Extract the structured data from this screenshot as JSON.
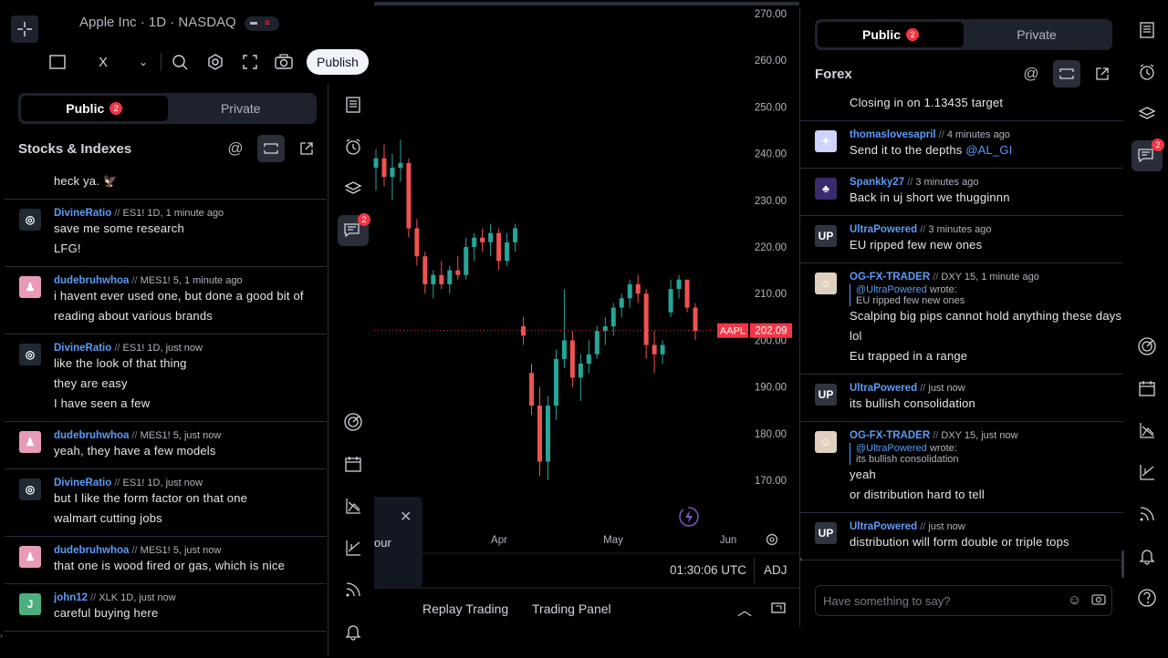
{
  "chart": {
    "symbol_title": "Apple Inc · 1D · NASDAQ",
    "toolbar": {
      "close_label": "X",
      "publish_label": "Publish"
    },
    "price_scale": [
      "270.00",
      "260.00",
      "250.00",
      "240.00",
      "230.00",
      "220.00",
      "210.00",
      "200.00",
      "190.00",
      "180.00",
      "170.00"
    ],
    "time_labels": [
      "Apr",
      "May",
      "Jun"
    ],
    "last_price": {
      "symbol": "AAPL",
      "price": "202.09"
    },
    "clock": "01:30:06 UTC",
    "adj_label": "ADJ",
    "toast_fragment": "our",
    "bottom_tabs": [
      "Replay Trading",
      "Trading Panel"
    ],
    "colors": {
      "up": "#26a69a",
      "down": "#ef5350",
      "accent": "#f23645"
    }
  },
  "chart_data": {
    "type": "candlestick",
    "title": "Apple Inc · 1D · NASDAQ",
    "ylim": [
      165,
      272
    ],
    "series": [
      {
        "name": "AAPL",
        "last": 202.09
      }
    ],
    "x_tick_labels": [
      "Apr",
      "May",
      "Jun"
    ],
    "candles": [
      {
        "o": 237,
        "h": 241,
        "l": 232,
        "c": 239
      },
      {
        "o": 239,
        "h": 242,
        "l": 233,
        "c": 235
      },
      {
        "o": 235,
        "h": 240,
        "l": 230,
        "c": 237
      },
      {
        "o": 237,
        "h": 243,
        "l": 234,
        "c": 238
      },
      {
        "o": 238,
        "h": 239,
        "l": 222,
        "c": 224
      },
      {
        "o": 224,
        "h": 226,
        "l": 216,
        "c": 218
      },
      {
        "o": 218,
        "h": 219,
        "l": 210,
        "c": 212
      },
      {
        "o": 212,
        "h": 215,
        "l": 209,
        "c": 214
      },
      {
        "o": 214,
        "h": 217,
        "l": 211,
        "c": 212
      },
      {
        "o": 212,
        "h": 216,
        "l": 210,
        "c": 215
      },
      {
        "o": 215,
        "h": 218,
        "l": 213,
        "c": 214
      },
      {
        "o": 214,
        "h": 222,
        "l": 213,
        "c": 220
      },
      {
        "o": 220,
        "h": 223,
        "l": 217,
        "c": 222
      },
      {
        "o": 222,
        "h": 224,
        "l": 219,
        "c": 221
      },
      {
        "o": 221,
        "h": 225,
        "l": 218,
        "c": 223
      },
      {
        "o": 223,
        "h": 224,
        "l": 215,
        "c": 217
      },
      {
        "o": 217,
        "h": 223,
        "l": 216,
        "c": 221
      },
      {
        "o": 221,
        "h": 225,
        "l": 219,
        "c": 224
      },
      {
        "o": 203,
        "h": 205,
        "l": 199,
        "c": 201
      },
      {
        "o": 193,
        "h": 195,
        "l": 184,
        "c": 186
      },
      {
        "o": 186,
        "h": 190,
        "l": 171,
        "c": 174
      },
      {
        "o": 174,
        "h": 188,
        "l": 170,
        "c": 186
      },
      {
        "o": 186,
        "h": 198,
        "l": 183,
        "c": 196
      },
      {
        "o": 196,
        "h": 211,
        "l": 194,
        "c": 200
      },
      {
        "o": 200,
        "h": 202,
        "l": 190,
        "c": 192
      },
      {
        "o": 192,
        "h": 197,
        "l": 187,
        "c": 195
      },
      {
        "o": 195,
        "h": 200,
        "l": 193,
        "c": 197
      },
      {
        "o": 197,
        "h": 203,
        "l": 196,
        "c": 202
      },
      {
        "o": 202,
        "h": 205,
        "l": 199,
        "c": 203
      },
      {
        "o": 203,
        "h": 208,
        "l": 201,
        "c": 207
      },
      {
        "o": 207,
        "h": 210,
        "l": 205,
        "c": 209
      },
      {
        "o": 209,
        "h": 213,
        "l": 207,
        "c": 212
      },
      {
        "o": 212,
        "h": 214,
        "l": 208,
        "c": 210
      },
      {
        "o": 210,
        "h": 211,
        "l": 196,
        "c": 199
      },
      {
        "o": 199,
        "h": 202,
        "l": 193,
        "c": 197
      },
      {
        "o": 197,
        "h": 200,
        "l": 195,
        "c": 199
      },
      {
        "o": 206,
        "h": 213,
        "l": 205,
        "c": 211
      },
      {
        "o": 211,
        "h": 214,
        "l": 209,
        "c": 213
      },
      {
        "o": 213,
        "h": 213,
        "l": 206,
        "c": 207
      },
      {
        "o": 207,
        "h": 208,
        "l": 200,
        "c": 202
      }
    ]
  },
  "left_chat": {
    "tabs": {
      "public": "Public",
      "public_badge": "2",
      "private": "Private"
    },
    "room": "Stocks & Indexes",
    "messages": [
      {
        "user": "",
        "meta": "",
        "lines": [
          "heck ya. 🦅"
        ],
        "avatar": "",
        "color": "#000"
      },
      {
        "user": "DivineRatio",
        "meta": "ES1! 1D, 1 minute ago",
        "lines": [
          "save me some research",
          "LFG!"
        ],
        "avatar": "◎",
        "color": "#1f2a33"
      },
      {
        "user": "dudebruhwhoa",
        "meta": "MES1! 5, 1 minute ago",
        "lines": [
          "i havent ever used one, but done a good bit of reading about various brands"
        ],
        "avatar": "♟",
        "color": "#e89bb8"
      },
      {
        "user": "DivineRatio",
        "meta": "ES1! 1D, just now",
        "lines": [
          "like the look of that thing",
          "they are easy",
          "I have seen a few"
        ],
        "avatar": "◎",
        "color": "#1f2a33"
      },
      {
        "user": "dudebruhwhoa",
        "meta": "MES1! 5, just now",
        "lines": [
          "yeah, they have a few models"
        ],
        "avatar": "♟",
        "color": "#e89bb8"
      },
      {
        "user": "DivineRatio",
        "meta": "ES1! 1D, just now",
        "lines": [
          "but I like the form factor on that one",
          "walmart cutting jobs"
        ],
        "avatar": "◎",
        "color": "#1f2a33"
      },
      {
        "user": "dudebruhwhoa",
        "meta": "MES1! 5, just now",
        "lines": [
          "that one is wood fired or gas, which is nice"
        ],
        "avatar": "♟",
        "color": "#e89bb8"
      },
      {
        "user": "john12",
        "meta": "XLK 1D, just now",
        "lines": [
          "careful buying here"
        ],
        "avatar": "J",
        "color": "#4caf7d"
      }
    ]
  },
  "middle_strip": {
    "chat_badge": "2"
  },
  "right_chat": {
    "tabs": {
      "public": "Public",
      "public_badge": "2",
      "private": "Private"
    },
    "room": "Forex",
    "messages": [
      {
        "user": "",
        "meta": "",
        "lines": [
          "Closing in on 1.13435 target"
        ],
        "avatar": "",
        "color": "#000"
      },
      {
        "user": "thomaslovesapril",
        "meta": "4 minutes ago",
        "lines": [
          "Send it to the depths"
        ],
        "mention": "@AL_GI",
        "avatar": "✦",
        "color": "#cfd3ff"
      },
      {
        "user": "Spankky27",
        "meta": "3 minutes ago",
        "lines": [
          "Back in uj short we thugginnn"
        ],
        "avatar": "♣",
        "color": "#3b2a6e"
      },
      {
        "user": "UltraPowered",
        "meta": "3 minutes ago",
        "lines": [
          "EU ripped few new ones"
        ],
        "avatar": "UP",
        "color": "#2f3540"
      },
      {
        "user": "OG-FX-TRADER",
        "meta": "DXY 15, 1 minute ago",
        "quote_user": "@UltraPowered",
        "quote_wrote": "wrote:",
        "quote_text": "EU ripped few new ones",
        "lines": [
          "Scalping big pips cannot hold anything these days lol",
          "Eu trapped in a range"
        ],
        "avatar": "☺",
        "color": "#e0d0c0"
      },
      {
        "user": "UltraPowered",
        "meta": "just now",
        "lines": [
          "its bullish consolidation"
        ],
        "avatar": "UP",
        "color": "#2f3540"
      },
      {
        "user": "OG-FX-TRADER",
        "meta": "DXY 15, just now",
        "quote_user": "@UltraPowered",
        "quote_wrote": "wrote:",
        "quote_text": "its bullish consolidation",
        "lines": [
          "yeah",
          "or distribution hard to tell"
        ],
        "avatar": "☺",
        "color": "#e0d0c0"
      },
      {
        "user": "UltraPowered",
        "meta": "just now",
        "lines": [
          "distribution will form double or triple tops"
        ],
        "avatar": "UP",
        "color": "#2f3540"
      }
    ],
    "input_placeholder": "Have something to say?"
  },
  "right_strip": {
    "chat_badge": "2"
  }
}
